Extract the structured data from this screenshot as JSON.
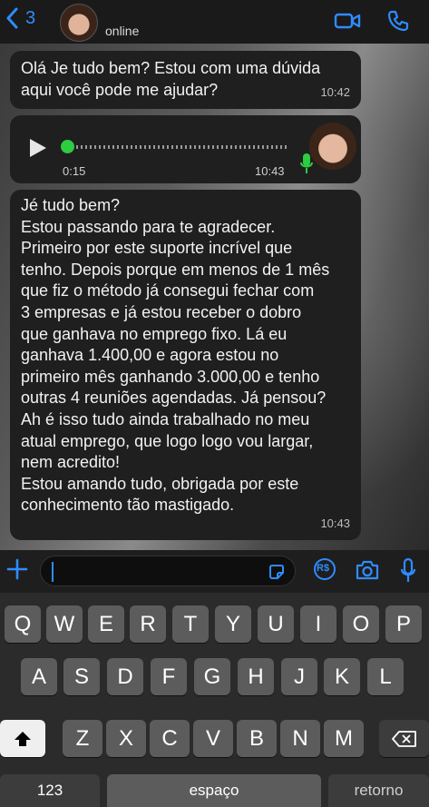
{
  "header": {
    "back_count": "3",
    "status": "online"
  },
  "messages": [
    {
      "lines": [
        "Olá Je tudo bem? Estou com uma dúvida",
        "aqui você pode me ajudar?"
      ],
      "time": "10:42"
    },
    {
      "audio_duration": "0:15",
      "time": "10:43"
    },
    {
      "lines": [
        "Jé tudo bem?",
        "Estou passando para te agradecer.",
        "Primeiro por este suporte incrível que",
        "tenho. Depois porque em menos de 1 mês",
        "que fiz o método já consegui fechar com",
        "3 empresas e já estou receber o dobro",
        "que ganhava no emprego fixo. Lá eu",
        "ganhava 1.400,00 e agora estou no",
        "primeiro mês ganhando 3.000,00 e tenho",
        "outras 4 reuniões agendadas. Já pensou?",
        "Ah é isso tudo ainda trabalhado no meu",
        "atual emprego, que logo logo vou largar,",
        "nem acredito!",
        "Estou amando tudo, obrigada por este",
        "conhecimento tão mastigado."
      ],
      "time": "10:43"
    }
  ],
  "input": {
    "payment_label": "R$"
  },
  "keyboard": {
    "row1": [
      "Q",
      "W",
      "E",
      "R",
      "T",
      "Y",
      "U",
      "I",
      "O",
      "P"
    ],
    "row2": [
      "A",
      "S",
      "D",
      "F",
      "G",
      "H",
      "J",
      "K",
      "L"
    ],
    "row3": [
      "Z",
      "X",
      "C",
      "V",
      "B",
      "N",
      "M"
    ],
    "numbers_label": "123",
    "space_label": "espaço",
    "return_label": "retorno"
  },
  "colors": {
    "accent": "#2f8cff",
    "bubble": "#1f1f1f",
    "mic_green": "#2ecc40"
  },
  "icons": [
    "back-chevron-icon",
    "video-call-icon",
    "phone-icon",
    "play-icon",
    "microphone-icon",
    "plus-icon",
    "sticker-icon",
    "payment-icon",
    "camera-icon",
    "shift-icon",
    "backspace-icon"
  ]
}
